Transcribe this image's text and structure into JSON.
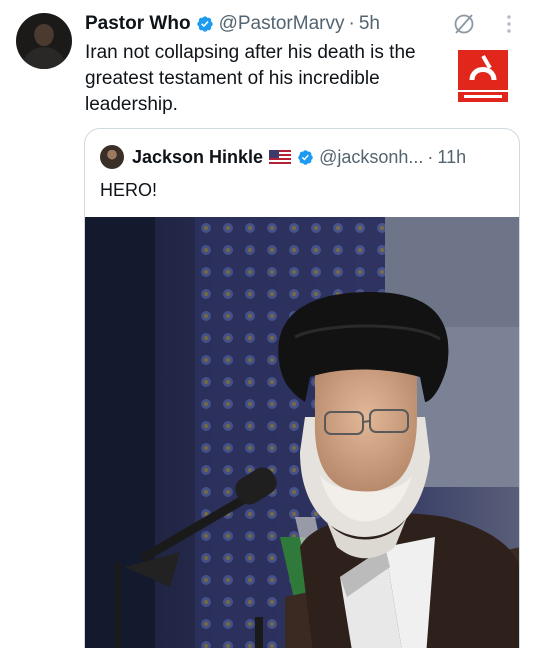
{
  "tweet": {
    "author_name": "Pastor Who",
    "author_handle": "@PastorMarvy",
    "separator": "·",
    "time": "5h",
    "text": "Iran not collapsing after his death is the greatest testament of his incredible leadership."
  },
  "quoted_tweet": {
    "author_name": "Jackson Hinkle",
    "author_handle": "@jacksonh...",
    "separator": "·",
    "time": "11h",
    "text": "HERO!"
  },
  "colors": {
    "verified_blue": "#1d9bf0",
    "secondary_text": "#536471",
    "watermark_red": "#e1261c"
  },
  "icons": [
    "verified-badge-icon",
    "grok-icon",
    "more-options-icon",
    "us-flag-icon"
  ]
}
